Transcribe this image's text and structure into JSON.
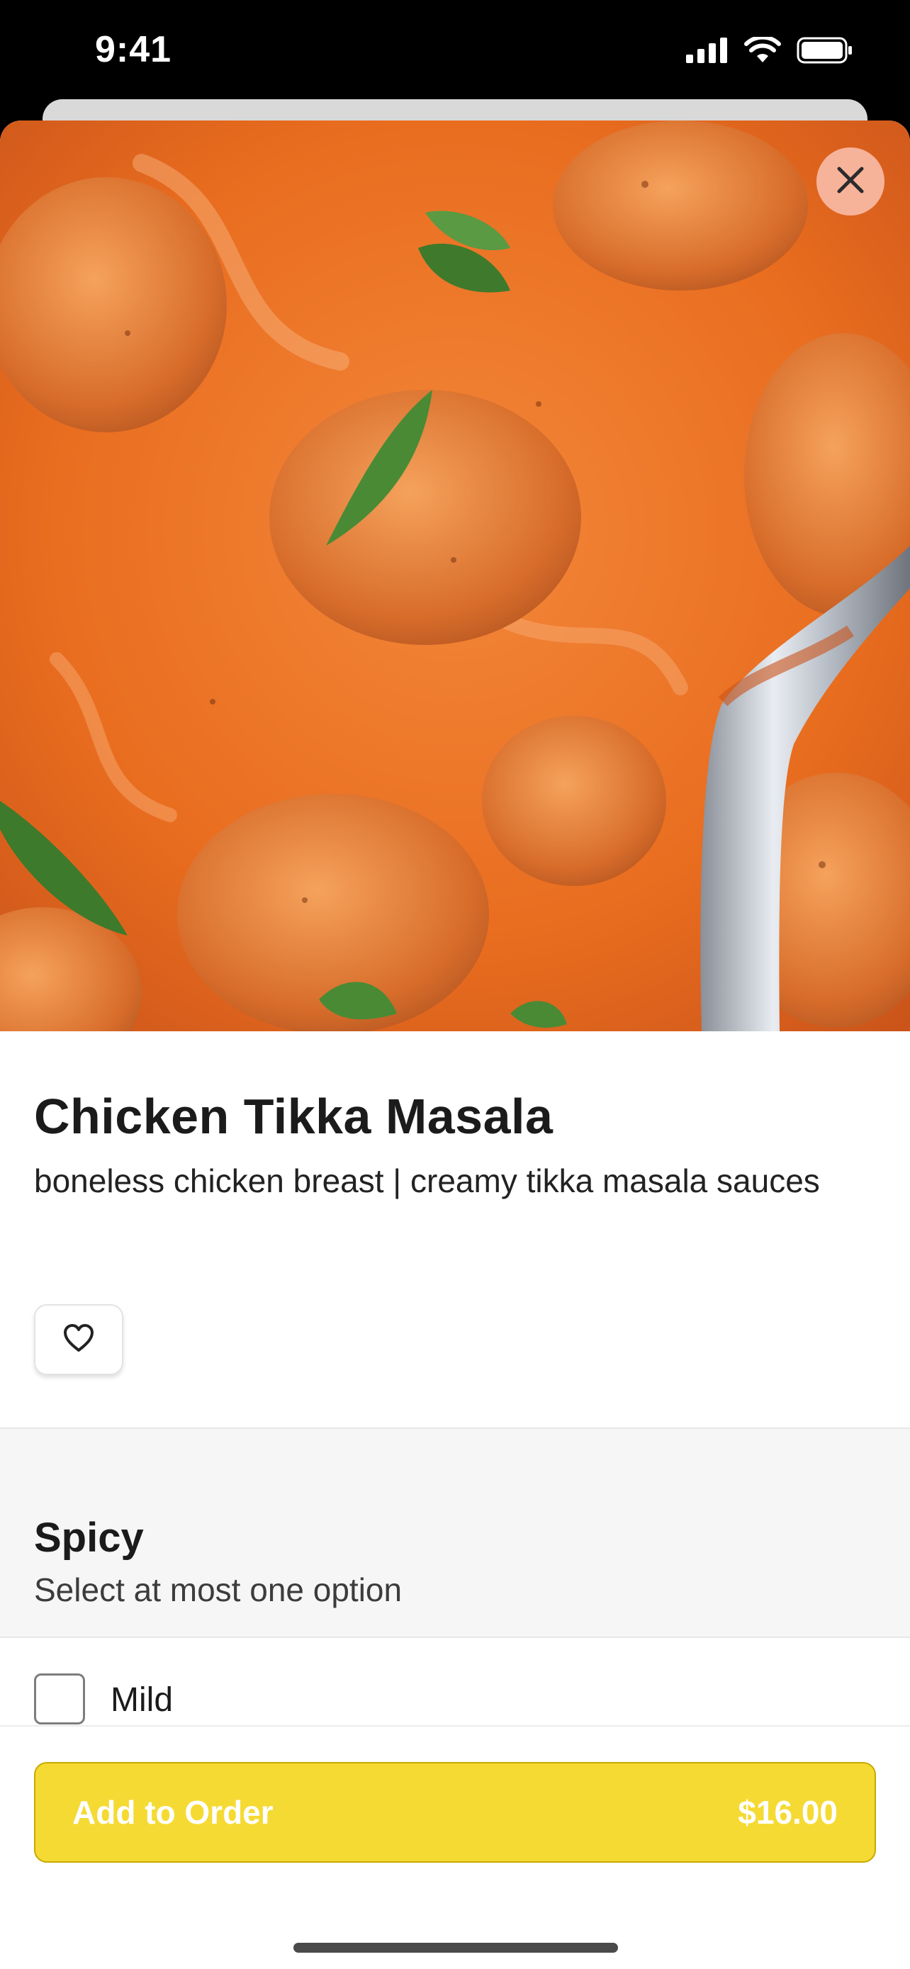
{
  "status_bar": {
    "time": "9:41",
    "icons": [
      "signal-icon",
      "wifi-icon",
      "battery-icon"
    ]
  },
  "close_icon": "close-icon",
  "item": {
    "name": "Chicken Tikka Masala",
    "description": "boneless chicken breast | creamy tikka masala sauces",
    "favorite_icon": "heart-icon"
  },
  "option_group": {
    "title": "Spicy",
    "subtitle": "Select at most one option",
    "options": [
      {
        "label": "Mild",
        "checked": false
      }
    ]
  },
  "cta": {
    "label": "Add to Order",
    "price": "$16.00"
  },
  "colors": {
    "accent": "#f5da33",
    "close_bg": "#f7b39a"
  }
}
